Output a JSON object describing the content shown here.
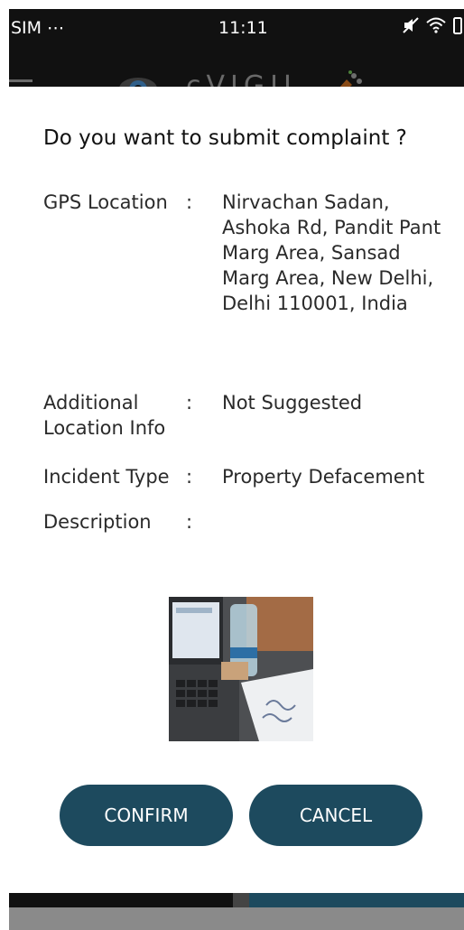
{
  "status_bar": {
    "carrier": "SIM ⋯",
    "time": "11:11",
    "icons": [
      "mute-icon",
      "wifi-icon",
      "battery-icon"
    ]
  },
  "app_bar": {
    "brand": "cVIGIL",
    "icons": [
      "menu-icon",
      "eye-icon",
      "brush-icon"
    ]
  },
  "dialog": {
    "title": "Do you want to submit complaint ?",
    "fields": [
      {
        "label": "GPS Location",
        "colon": ":",
        "value": "Nirvachan Sadan, Ashoka Rd, Pandit Pant Marg Area, Sansad Marg Area, New Delhi, Delhi 110001, India"
      },
      {
        "label": "Additional Location Info",
        "colon": ":",
        "value": "Not Suggested"
      },
      {
        "label": "Incident Type",
        "colon": ":",
        "value": "Property Defacement"
      },
      {
        "label": "Description",
        "colon": ":",
        "value": ""
      }
    ],
    "buttons": {
      "confirm": "CONFIRM",
      "cancel": "CANCEL"
    }
  },
  "colors": {
    "button_bg": "#1d4a5e",
    "button_text": "#ffffff",
    "status_bar_bg": "#111111"
  }
}
